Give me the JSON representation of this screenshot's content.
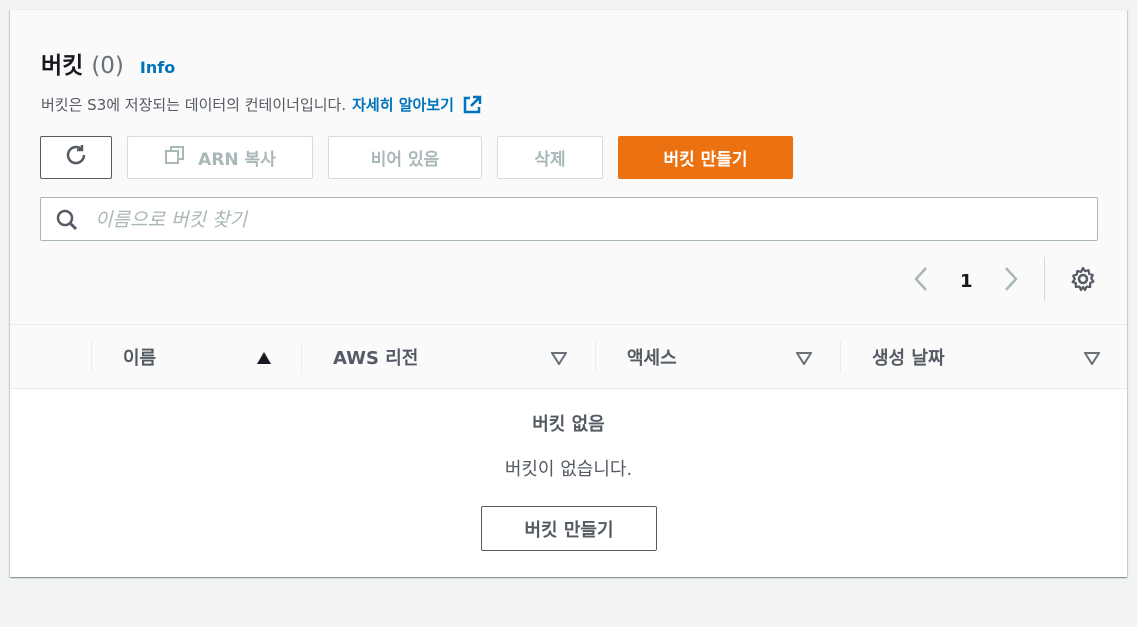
{
  "header": {
    "title": "버킷",
    "count": "(0)",
    "info_label": "Info",
    "description": "버킷은 S3에 저장되는 데이터의 컨테이너입니다.",
    "learn_more": "자세히 알아보기"
  },
  "toolbar": {
    "copy_arn_label": "ARN 복사",
    "empty_label": "비어 있음",
    "delete_label": "삭제",
    "create_label": "버킷 만들기"
  },
  "search": {
    "placeholder": "이름으로 버킷 찾기",
    "value": ""
  },
  "pagination": {
    "current_page": "1"
  },
  "table": {
    "columns": [
      {
        "label": "이름",
        "sort": "ascending"
      },
      {
        "label": "AWS 리전",
        "sort": "none"
      },
      {
        "label": "액세스",
        "sort": "none"
      },
      {
        "label": "생성 날짜",
        "sort": "none"
      }
    ],
    "rows": []
  },
  "empty_state": {
    "title": "버킷 없음",
    "description": "버킷이 없습니다.",
    "create_label": "버킷 만들기"
  },
  "colors": {
    "primary_button": "#ec7211",
    "link": "#0073bb",
    "disabled_text": "#aab7b8",
    "page_background": "#f2f3f3"
  },
  "icons": [
    "refresh-icon",
    "copy-icon",
    "external-link-icon",
    "search-icon",
    "chevron-left-icon",
    "chevron-right-icon",
    "settings-gear-icon",
    "sort-ascending-icon",
    "sort-descending-icon"
  ]
}
